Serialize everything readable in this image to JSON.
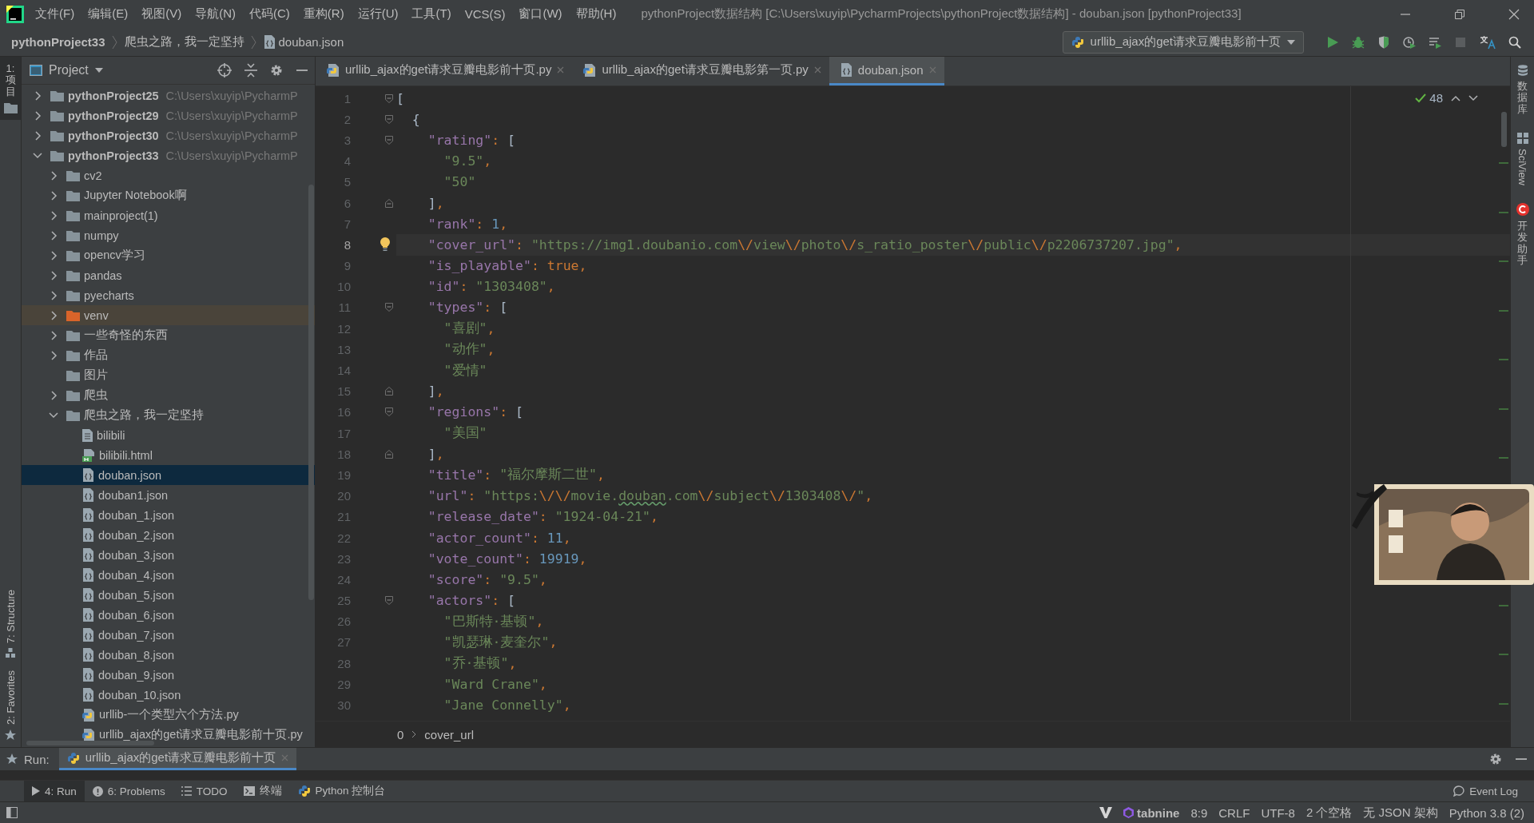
{
  "window": {
    "title": "pythonProject数据结构 [C:\\Users\\xuyip\\PycharmProjects\\pythonProject数据结构] - douban.json [pythonProject33]",
    "menu": [
      "文件(F)",
      "编辑(E)",
      "视图(V)",
      "导航(N)",
      "代码(C)",
      "重构(R)",
      "运行(U)",
      "工具(T)",
      "VCS(S)",
      "窗口(W)",
      "帮助(H)"
    ]
  },
  "navigation_bar": {
    "breadcrumbs": [
      {
        "label": "pythonProject33",
        "kind": "project"
      },
      {
        "label": "爬虫之路，我一定坚持",
        "kind": "folder"
      },
      {
        "label": "douban.json",
        "kind": "json"
      }
    ],
    "run_configuration": "urllib_ajax的get请求豆瓣电影前十页"
  },
  "left_strip": [
    {
      "label": "1: 项目",
      "kind": "cjk",
      "selected": true
    },
    {
      "label": "7: Structure",
      "kind": "latin",
      "selected": false
    },
    {
      "label": "2: Favorites",
      "kind": "latin",
      "selected": false
    }
  ],
  "project_panel": {
    "title": "Project",
    "tree": [
      {
        "label": "pythonProject25",
        "kind": "project",
        "hint": "C:\\Users\\xuyip\\PycharmP",
        "expanded": false,
        "selected": false
      },
      {
        "label": "pythonProject29",
        "kind": "project",
        "hint": "C:\\Users\\xuyip\\PycharmP",
        "expanded": false,
        "selected": false
      },
      {
        "label": "pythonProject30",
        "kind": "project",
        "hint": "C:\\Users\\xuyip\\PycharmP",
        "expanded": false,
        "selected": false
      },
      {
        "label": "pythonProject33",
        "kind": "project",
        "hint": "C:\\Users\\xuyip\\PycharmP",
        "expanded": true,
        "selected": false,
        "children": [
          {
            "label": "cv2",
            "kind": "folder",
            "expanded": false,
            "selected": false
          },
          {
            "label": "Jupyter Notebook啊",
            "kind": "folder",
            "expanded": false,
            "selected": false
          },
          {
            "label": "mainproject(1)",
            "kind": "folder",
            "expanded": false,
            "selected": false
          },
          {
            "label": "numpy",
            "kind": "folder",
            "expanded": false,
            "selected": false
          },
          {
            "label": "opencv学习",
            "kind": "folder",
            "expanded": false,
            "selected": false
          },
          {
            "label": "pandas",
            "kind": "folder",
            "expanded": false,
            "selected": false
          },
          {
            "label": "pyecharts",
            "kind": "folder",
            "expanded": false,
            "selected": false
          },
          {
            "label": "venv",
            "kind": "excluded",
            "expanded": false,
            "selected": false
          },
          {
            "label": "一些奇怪的东西",
            "kind": "folder",
            "expanded": false,
            "selected": false
          },
          {
            "label": "作品",
            "kind": "folder",
            "expanded": false,
            "selected": false
          },
          {
            "label": "图片",
            "kind": "folder",
            "selected": false
          },
          {
            "label": "爬虫",
            "kind": "folder",
            "expanded": false,
            "selected": false
          },
          {
            "label": "爬虫之路，我一定坚持",
            "kind": "folder",
            "expanded": true,
            "selected": false,
            "children": [
              {
                "label": "bilibili",
                "kind": "text",
                "selected": false
              },
              {
                "label": "bilibili.html",
                "kind": "html",
                "selected": false
              },
              {
                "label": "douban.json",
                "kind": "json",
                "selected": true
              },
              {
                "label": "douban1.json",
                "kind": "json",
                "selected": false
              },
              {
                "label": "douban_1.json",
                "kind": "json",
                "selected": false
              },
              {
                "label": "douban_2.json",
                "kind": "json",
                "selected": false
              },
              {
                "label": "douban_3.json",
                "kind": "json",
                "selected": false
              },
              {
                "label": "douban_4.json",
                "kind": "json",
                "selected": false
              },
              {
                "label": "douban_5.json",
                "kind": "json",
                "selected": false
              },
              {
                "label": "douban_6.json",
                "kind": "json",
                "selected": false
              },
              {
                "label": "douban_7.json",
                "kind": "json",
                "selected": false
              },
              {
                "label": "douban_8.json",
                "kind": "json",
                "selected": false
              },
              {
                "label": "douban_9.json",
                "kind": "json",
                "selected": false
              },
              {
                "label": "douban_10.json",
                "kind": "json",
                "selected": false
              },
              {
                "label": "urllib-一个类型六个方法.py",
                "kind": "py",
                "selected": false
              },
              {
                "label": "urllib_ajax的get请求豆瓣电影前十页.py",
                "kind": "py",
                "selected": false
              }
            ]
          }
        ]
      }
    ]
  },
  "editor": {
    "tabs": [
      {
        "label": "urllib_ajax的get请求豆瓣电影前十页.py",
        "kind": "py",
        "selected": false
      },
      {
        "label": "urllib_ajax的get请求豆瓣电影第一页.py",
        "kind": "py",
        "selected": false
      },
      {
        "label": "douban.json",
        "kind": "json",
        "selected": true
      }
    ],
    "inspection_count": "48",
    "lines": [
      {
        "n": "1",
        "kind": "fold_start",
        "current": false,
        "tokens": [
          {
            "kind": "bracket",
            "text": "["
          }
        ]
      },
      {
        "n": "2",
        "kind": "fold_start",
        "current": false,
        "tokens": [
          {
            "kind": "bracket",
            "text": "  {"
          }
        ]
      },
      {
        "n": "3",
        "kind": "fold_start",
        "current": false,
        "tokens": [
          {
            "kind": "key",
            "text": "    \"rating\""
          },
          {
            "kind": "punct",
            "text": ": "
          },
          {
            "kind": "bracket",
            "text": "["
          }
        ]
      },
      {
        "n": "4",
        "kind": "plain",
        "current": false,
        "tokens": [
          {
            "kind": "string",
            "text": "      \"9.5\""
          },
          {
            "kind": "punct",
            "text": ","
          }
        ]
      },
      {
        "n": "5",
        "kind": "plain",
        "current": false,
        "tokens": [
          {
            "kind": "string",
            "text": "      \"50\""
          }
        ]
      },
      {
        "n": "6",
        "kind": "fold_end",
        "current": false,
        "tokens": [
          {
            "kind": "bracket",
            "text": "    ]"
          },
          {
            "kind": "punct",
            "text": ","
          }
        ]
      },
      {
        "n": "7",
        "kind": "plain",
        "current": false,
        "tokens": [
          {
            "kind": "key",
            "text": "    \"rank\""
          },
          {
            "kind": "punct",
            "text": ": "
          },
          {
            "kind": "number",
            "text": "1"
          },
          {
            "kind": "punct",
            "text": ","
          }
        ]
      },
      {
        "n": "8",
        "kind": "plain",
        "current": true,
        "tokens": [
          {
            "kind": "key",
            "text": "    \"cover_url\""
          },
          {
            "kind": "punct",
            "text": ": "
          },
          {
            "kind": "string",
            "text": "\"https://img1.doubanio.com"
          },
          {
            "kind": "escape",
            "text": "\\/"
          },
          {
            "kind": "string",
            "text": "view"
          },
          {
            "kind": "escape",
            "text": "\\/"
          },
          {
            "kind": "string",
            "text": "photo"
          },
          {
            "kind": "escape",
            "text": "\\/"
          },
          {
            "kind": "string",
            "text": "s_ratio_poster"
          },
          {
            "kind": "escape",
            "text": "\\/"
          },
          {
            "kind": "string",
            "text": "public"
          },
          {
            "kind": "escape",
            "text": "\\/"
          },
          {
            "kind": "string",
            "text": "p2206737207.jpg\""
          },
          {
            "kind": "punct",
            "text": ","
          }
        ]
      },
      {
        "n": "9",
        "kind": "plain",
        "current": false,
        "tokens": [
          {
            "kind": "key",
            "text": "    \"is_playable\""
          },
          {
            "kind": "punct",
            "text": ": "
          },
          {
            "kind": "keyword",
            "text": "true"
          },
          {
            "kind": "punct",
            "text": ","
          }
        ]
      },
      {
        "n": "10",
        "kind": "plain",
        "current": false,
        "tokens": [
          {
            "kind": "key",
            "text": "    \"id\""
          },
          {
            "kind": "punct",
            "text": ": "
          },
          {
            "kind": "string",
            "text": "\"1303408\""
          },
          {
            "kind": "punct",
            "text": ","
          }
        ]
      },
      {
        "n": "11",
        "kind": "fold_start",
        "current": false,
        "tokens": [
          {
            "kind": "key",
            "text": "    \"types\""
          },
          {
            "kind": "punct",
            "text": ": "
          },
          {
            "kind": "bracket",
            "text": "["
          }
        ]
      },
      {
        "n": "12",
        "kind": "plain",
        "current": false,
        "tokens": [
          {
            "kind": "string",
            "text": "      \"喜剧\""
          },
          {
            "kind": "punct",
            "text": ","
          }
        ]
      },
      {
        "n": "13",
        "kind": "plain",
        "current": false,
        "tokens": [
          {
            "kind": "string",
            "text": "      \"动作\""
          },
          {
            "kind": "punct",
            "text": ","
          }
        ]
      },
      {
        "n": "14",
        "kind": "plain",
        "current": false,
        "tokens": [
          {
            "kind": "string",
            "text": "      \"爱情\""
          }
        ]
      },
      {
        "n": "15",
        "kind": "fold_end",
        "current": false,
        "tokens": [
          {
            "kind": "bracket",
            "text": "    ]"
          },
          {
            "kind": "punct",
            "text": ","
          }
        ]
      },
      {
        "n": "16",
        "kind": "fold_start",
        "current": false,
        "tokens": [
          {
            "kind": "key",
            "text": "    \"regions\""
          },
          {
            "kind": "punct",
            "text": ": "
          },
          {
            "kind": "bracket",
            "text": "["
          }
        ]
      },
      {
        "n": "17",
        "kind": "plain",
        "current": false,
        "tokens": [
          {
            "kind": "string",
            "text": "      \"美国\""
          }
        ]
      },
      {
        "n": "18",
        "kind": "fold_end",
        "current": false,
        "tokens": [
          {
            "kind": "bracket",
            "text": "    ]"
          },
          {
            "kind": "punct",
            "text": ","
          }
        ]
      },
      {
        "n": "19",
        "kind": "plain",
        "current": false,
        "tokens": [
          {
            "kind": "key",
            "text": "    \"title\""
          },
          {
            "kind": "punct",
            "text": ": "
          },
          {
            "kind": "string",
            "text": "\"福尔摩斯二世\""
          },
          {
            "kind": "punct",
            "text": ","
          }
        ]
      },
      {
        "n": "20",
        "kind": "plain",
        "current": false,
        "tokens": [
          {
            "kind": "key",
            "text": "    \"url\""
          },
          {
            "kind": "punct",
            "text": ": "
          },
          {
            "kind": "string",
            "text": "\"https:"
          },
          {
            "kind": "escape",
            "text": "\\/"
          },
          {
            "kind": "escape",
            "text": "\\/"
          },
          {
            "kind": "string",
            "text": "movie."
          },
          {
            "kind": "typo",
            "text": "douban"
          },
          {
            "kind": "string",
            "text": ".com"
          },
          {
            "kind": "escape",
            "text": "\\/"
          },
          {
            "kind": "string",
            "text": "subject"
          },
          {
            "kind": "escape",
            "text": "\\/"
          },
          {
            "kind": "string",
            "text": "1303408"
          },
          {
            "kind": "escape",
            "text": "\\/"
          },
          {
            "kind": "string",
            "text": "\""
          },
          {
            "kind": "punct",
            "text": ","
          }
        ]
      },
      {
        "n": "21",
        "kind": "plain",
        "current": false,
        "tokens": [
          {
            "kind": "key",
            "text": "    \"release_date\""
          },
          {
            "kind": "punct",
            "text": ": "
          },
          {
            "kind": "string",
            "text": "\"1924-04-21\""
          },
          {
            "kind": "punct",
            "text": ","
          }
        ]
      },
      {
        "n": "22",
        "kind": "plain",
        "current": false,
        "tokens": [
          {
            "kind": "key",
            "text": "    \"actor_count\""
          },
          {
            "kind": "punct",
            "text": ": "
          },
          {
            "kind": "number",
            "text": "11"
          },
          {
            "kind": "punct",
            "text": ","
          }
        ]
      },
      {
        "n": "23",
        "kind": "plain",
        "current": false,
        "tokens": [
          {
            "kind": "key",
            "text": "    \"vote_count\""
          },
          {
            "kind": "punct",
            "text": ": "
          },
          {
            "kind": "number",
            "text": "19919"
          },
          {
            "kind": "punct",
            "text": ","
          }
        ]
      },
      {
        "n": "24",
        "kind": "plain",
        "current": false,
        "tokens": [
          {
            "kind": "key",
            "text": "    \"score\""
          },
          {
            "kind": "punct",
            "text": ": "
          },
          {
            "kind": "string",
            "text": "\"9.5\""
          },
          {
            "kind": "punct",
            "text": ","
          }
        ]
      },
      {
        "n": "25",
        "kind": "fold_start",
        "current": false,
        "tokens": [
          {
            "kind": "key",
            "text": "    \"actors\""
          },
          {
            "kind": "punct",
            "text": ": "
          },
          {
            "kind": "bracket",
            "text": "["
          }
        ]
      },
      {
        "n": "26",
        "kind": "plain",
        "current": false,
        "tokens": [
          {
            "kind": "string",
            "text": "      \"巴斯特·基顿\""
          },
          {
            "kind": "punct",
            "text": ","
          }
        ]
      },
      {
        "n": "27",
        "kind": "plain",
        "current": false,
        "tokens": [
          {
            "kind": "string",
            "text": "      \"凯瑟琳·麦奎尔\""
          },
          {
            "kind": "punct",
            "text": ","
          }
        ]
      },
      {
        "n": "28",
        "kind": "plain",
        "current": false,
        "tokens": [
          {
            "kind": "string",
            "text": "      \"乔·基顿\""
          },
          {
            "kind": "punct",
            "text": ","
          }
        ]
      },
      {
        "n": "29",
        "kind": "plain",
        "current": false,
        "tokens": [
          {
            "kind": "string",
            "text": "      \"Ward Crane\""
          },
          {
            "kind": "punct",
            "text": ","
          }
        ]
      },
      {
        "n": "30",
        "kind": "plain",
        "current": false,
        "tokens": [
          {
            "kind": "string",
            "text": "      \"Jane Connelly\""
          },
          {
            "kind": "punct",
            "text": ","
          }
        ]
      }
    ],
    "breadcrumb": [
      "0",
      "cover_url"
    ],
    "overlay": {
      "kind": "picture"
    }
  },
  "right_strip": [
    {
      "label": "数据库",
      "kind": "cjk"
    },
    {
      "label": "SciView",
      "kind": "latin"
    },
    {
      "label": "开发助手",
      "kind": "cjk"
    }
  ],
  "run_panel": {
    "label": "Run:",
    "tab": "urllib_ajax的get请求豆瓣电影前十页"
  },
  "tool_tabs": [
    {
      "label": "4: Run",
      "selected": true
    },
    {
      "label": "6: Problems",
      "selected": false
    },
    {
      "label": "TODO",
      "selected": false
    },
    {
      "label": "终端",
      "selected": false
    },
    {
      "label": "Python 控制台",
      "selected": false
    }
  ],
  "event_log": "Event Log",
  "status_bar": {
    "plugin": "tabnine",
    "items": [
      "8:9",
      "CRLF",
      "UTF-8",
      "2 个空格",
      "无 JSON 架构",
      "Python 3.8 (2)"
    ]
  }
}
